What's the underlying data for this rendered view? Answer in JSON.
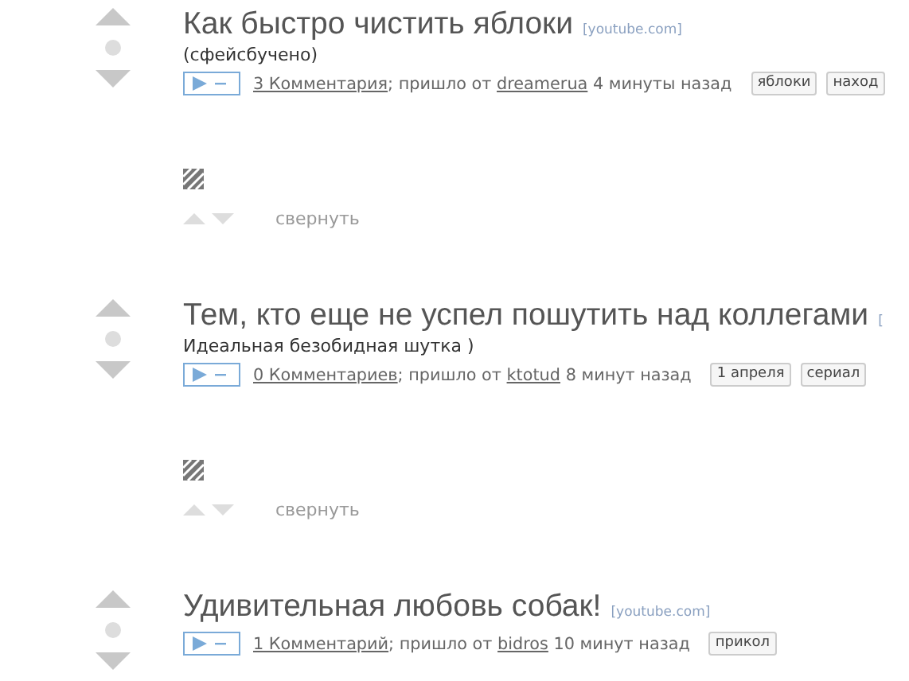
{
  "posts": [
    {
      "title": "Как быстро чистить яблоки",
      "source": "[youtube.com]",
      "description": "(сфейсбучено)",
      "comments": "3 Комментария",
      "from_label": "; пришло от",
      "author": "dreamerua",
      "time": "4 минуты назад",
      "tags": [
        "яблоки",
        "наход"
      ],
      "collapse_label": "свернуть"
    },
    {
      "title": "Тем, кто еще не успел пошутить над коллегами",
      "source": "[",
      "description": "Идеальная безобидная шутка )",
      "comments": "0 Комментариев",
      "from_label": "; пришло от",
      "author": "ktotud",
      "time": "8 минут назад",
      "tags": [
        "1 апреля",
        "сериал"
      ],
      "collapse_label": "свернуть"
    },
    {
      "title": "Удивительная любовь собак!",
      "source": "[youtube.com]",
      "comments": "1 Комментарий",
      "from_label": "; пришло от",
      "author": "bidros",
      "time": "10 минут назад",
      "tags": [
        "прикол"
      ]
    }
  ]
}
